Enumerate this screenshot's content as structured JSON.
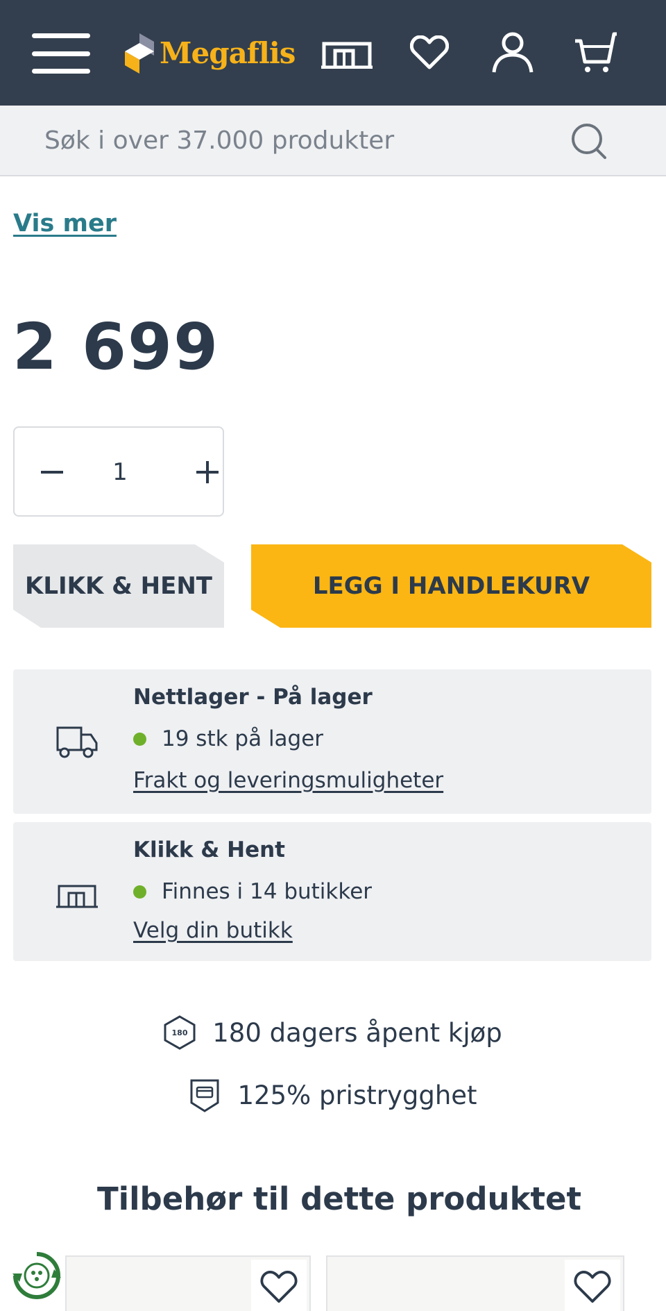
{
  "header": {
    "brand": "Megaflis",
    "colors": {
      "background": "#333f4e",
      "brand": "#f7b21a"
    },
    "icons": [
      "menu-icon",
      "store-icon",
      "heart-icon",
      "user-icon",
      "cart-icon"
    ]
  },
  "search": {
    "placeholder": "Søk i over 37.000 produkter"
  },
  "product": {
    "show_more": "Vis mer",
    "price": "2 699",
    "quantity": "1"
  },
  "actions": {
    "click_collect": "KLIKK & HENT",
    "add_to_cart": "LEGG I HANDLEKURV",
    "colors": {
      "add_to_cart": "#fbb614",
      "click_collect": "#e6e7e9"
    }
  },
  "stock": [
    {
      "title": "Nettlager - På lager",
      "status": "19 stk på lager",
      "link": "Frakt og leveringsmuligheter",
      "icon": "truck-icon"
    },
    {
      "title": "Klikk & Hent",
      "status": "Finnes i 14 butikker",
      "link": "Velg din butikk",
      "icon": "store-icon"
    }
  ],
  "status_color": "#6fb02a",
  "usps": [
    {
      "text": "180 dagers åpent kjøp",
      "badge": "180",
      "icon": "hexagon-180-icon"
    },
    {
      "text": "125% pristrygghet",
      "icon": "price-guarantee-icon"
    }
  ],
  "accessories": {
    "title": "Tilbehør til dette produktet"
  }
}
